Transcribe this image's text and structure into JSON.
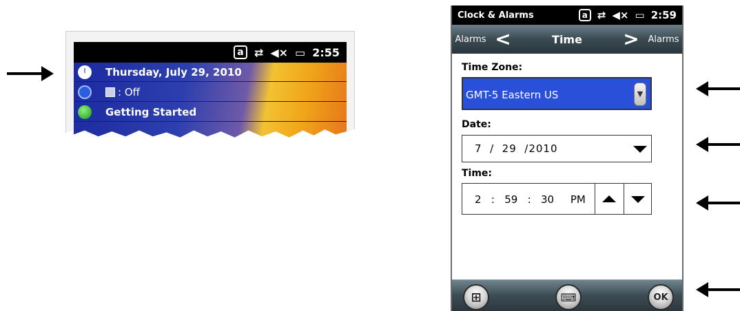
{
  "left_clip": {
    "status_icons": [
      "a-icon",
      "sync-arrows-icon",
      "speaker-muted-icon",
      "battery-icon"
    ],
    "status_a": "a",
    "status_sync": "⇄",
    "status_mute": "◀×",
    "status_battery": "▭",
    "status_time": "2:55",
    "rows": [
      {
        "icon": "clock-icon",
        "label": "Thursday, July 29, 2010"
      },
      {
        "icon": "wireless-icon",
        "label": ": Off"
      },
      {
        "icon": "getting-started-icon",
        "label": "Getting Started"
      }
    ]
  },
  "phone": {
    "status": {
      "title": "Clock & Alarms",
      "a": "a",
      "sync": "⇄",
      "mute": "◀×",
      "battery": "▭",
      "time": "2:59"
    },
    "tabs": {
      "left": "Alarms",
      "center": "Time",
      "right": "Alarms",
      "prev_glyph": "<",
      "next_glyph": ">"
    },
    "time_zone": {
      "label": "Time Zone:",
      "value": "GMT-5 Eastern US",
      "button_glyph": "▼"
    },
    "date": {
      "label": "Date:",
      "value": "7  /  29  /2010"
    },
    "time": {
      "label": "Time:",
      "value": "2   :   59   :   30     PM"
    },
    "bottom": {
      "start_glyph": "⊞",
      "keyboard_glyph": "⌨",
      "ok_label": "OK"
    }
  }
}
